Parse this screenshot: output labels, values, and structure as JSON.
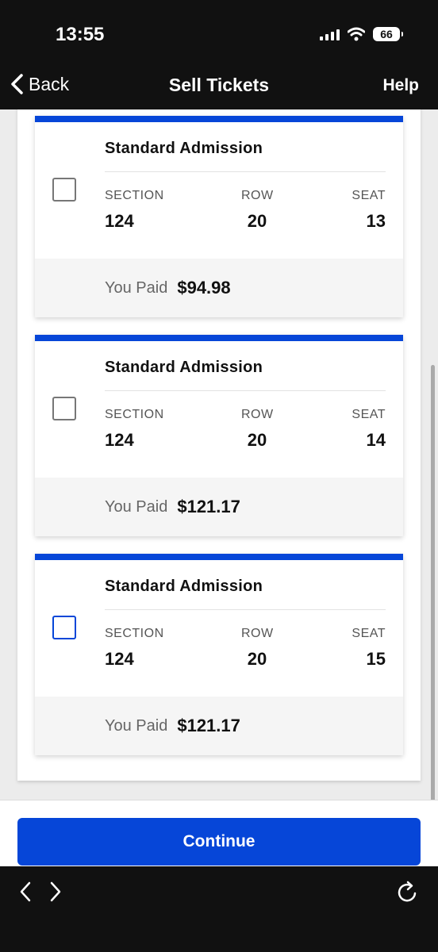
{
  "status_bar": {
    "time": "13:55",
    "battery": "66"
  },
  "nav": {
    "back_label": "Back",
    "title": "Sell Tickets",
    "help_label": "Help"
  },
  "labels": {
    "section": "SECTION",
    "row": "ROW",
    "seat": "SEAT",
    "you_paid": "You Paid"
  },
  "tickets": [
    {
      "type": "Standard Admission",
      "section": "124",
      "row": "20",
      "seat": "13",
      "paid": "$94.98",
      "checked": false
    },
    {
      "type": "Standard Admission",
      "section": "124",
      "row": "20",
      "seat": "14",
      "paid": "$121.17",
      "checked": false
    },
    {
      "type": "Standard Admission",
      "section": "124",
      "row": "20",
      "seat": "15",
      "paid": "$121.17",
      "checked": false
    }
  ],
  "continue_label": "Continue",
  "colors": {
    "accent": "#0646d8",
    "bar_bg": "#111111"
  },
  "icons": {
    "back": "chevron-left-icon",
    "forward": "chevron-right-icon",
    "reload": "reload-icon"
  }
}
